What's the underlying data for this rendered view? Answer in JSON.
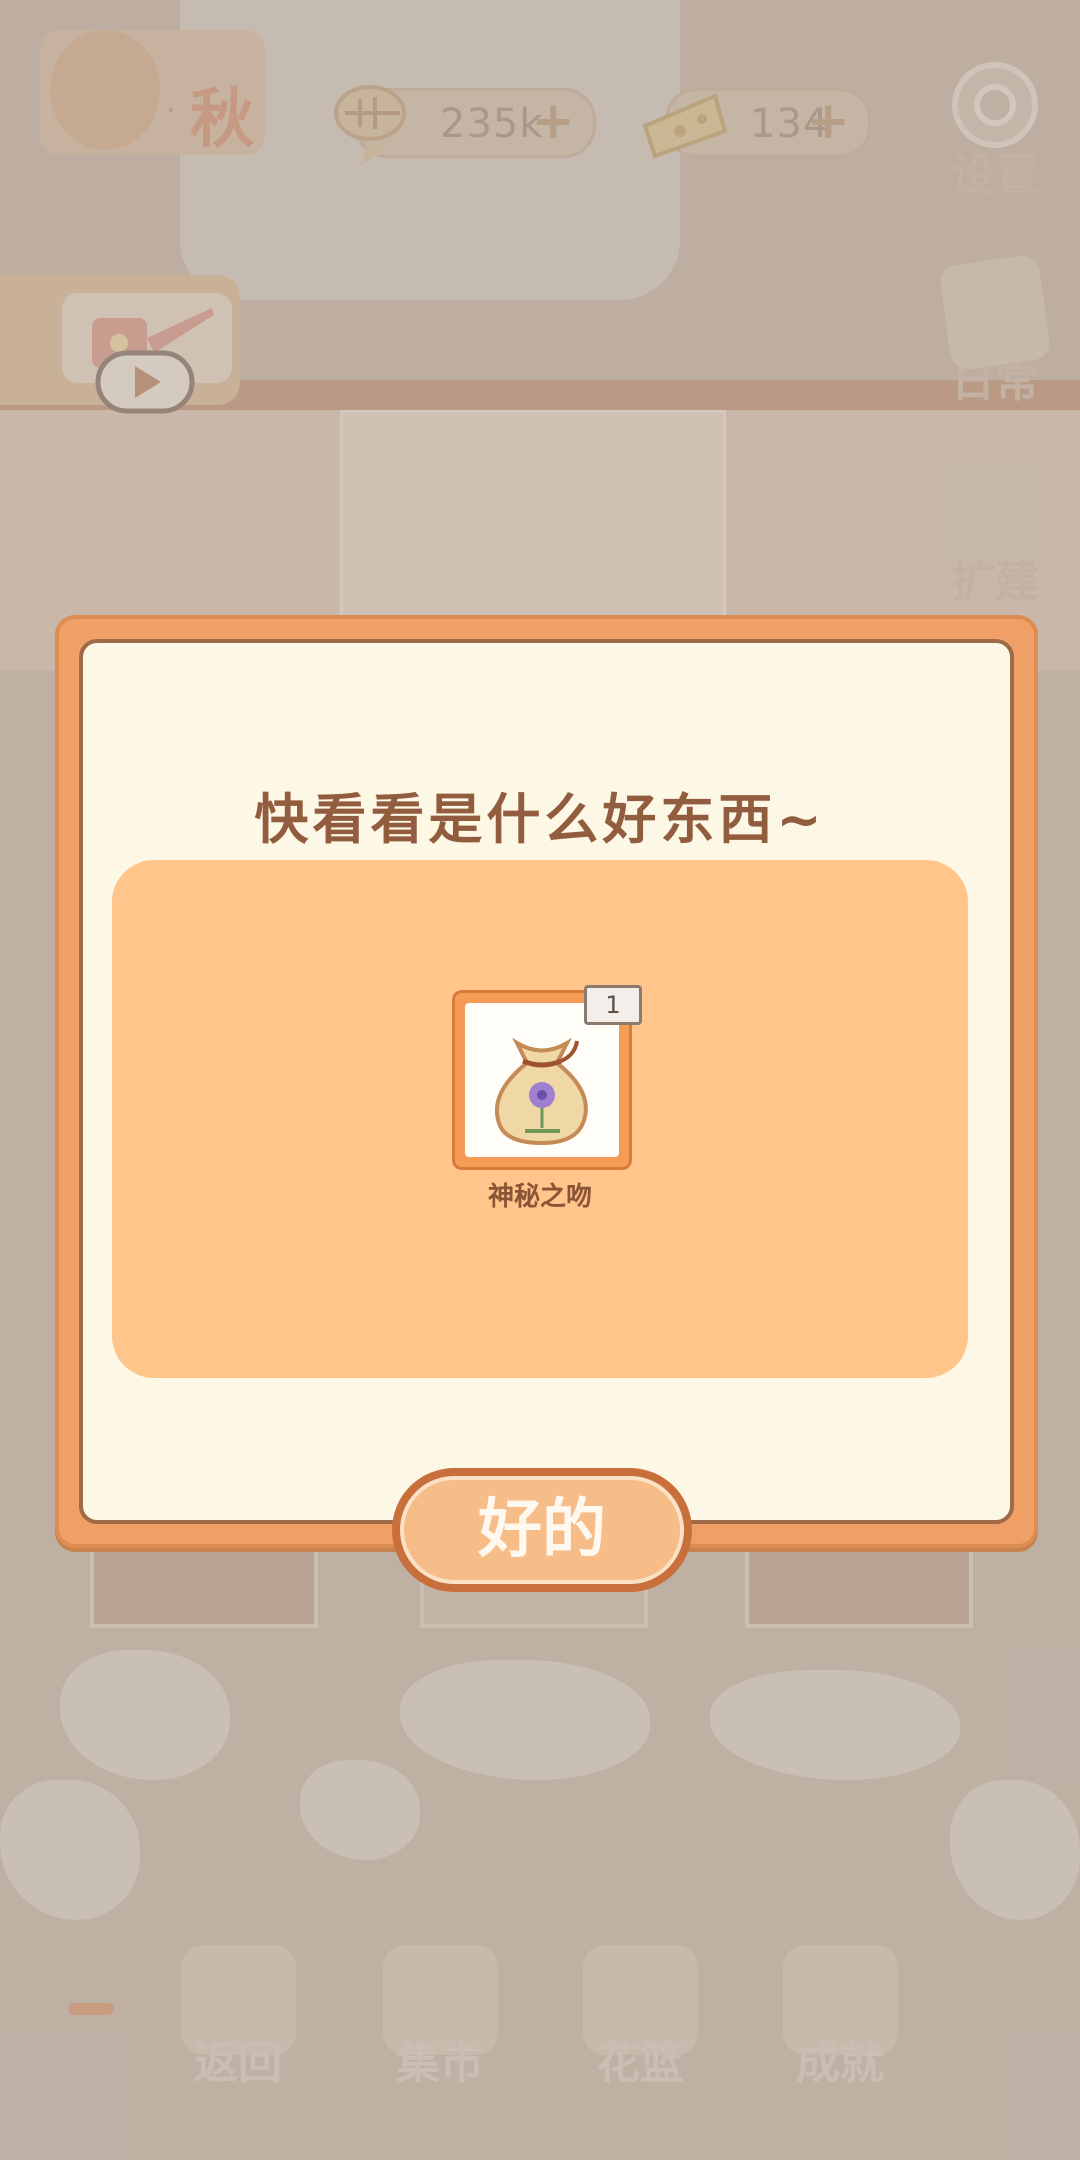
{
  "season": {
    "label": "秋"
  },
  "currencies": [
    {
      "icon": "fishbone-icon",
      "value": "235k"
    },
    {
      "icon": "cheese-icon",
      "value": "134"
    }
  ],
  "side_menu": [
    {
      "icon": "gear-icon",
      "label": "设置"
    },
    {
      "icon": "notepad-icon",
      "label": "日常"
    },
    {
      "icon": "hammer-icon",
      "label": "扩建"
    }
  ],
  "watering_can_button": {
    "icon": "play-icon"
  },
  "dialog": {
    "title": "快看看是什么好东西~",
    "reward": {
      "icon": "flower-seed-bag-icon",
      "count": "1",
      "name": "神秘之吻"
    },
    "confirm_label": "好的"
  },
  "bottom_nav": [
    {
      "icon": "door-icon",
      "label": "返回"
    },
    {
      "icon": "market-stall-icon",
      "label": "集市"
    },
    {
      "icon": "flower-basket-icon",
      "label": "花篮"
    },
    {
      "icon": "trophy-icon",
      "label": "成就"
    }
  ],
  "colors": {
    "dialog_border": "#f0a066",
    "dialog_bg": "#fdf7e6",
    "reward_panel": "#ffc58a",
    "title_text": "#925c3e"
  }
}
